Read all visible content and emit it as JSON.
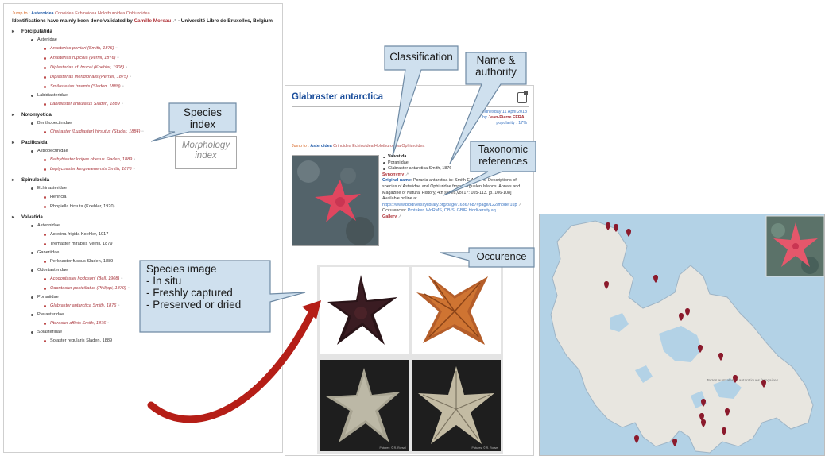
{
  "index": {
    "jump": {
      "label": "Jump to :",
      "active": "Asteroidea",
      "others": "Crinoidea Echinoidea Holothuroidea Ophiuroidea"
    },
    "credit": {
      "prefix": "Identifications have mainly been done/validated by",
      "name": "Camille Moreau",
      "suffix": "- Université Libre de Bruxelles, Belgium"
    },
    "orders": [
      {
        "name": "Forcipulatida",
        "families": [
          {
            "name": "Asteriidae",
            "species": [
              {
                "name": "Anasterias perrieri (Smith, 1876)",
                "linked": true
              },
              {
                "name": "Anasterias rupicola (Verrill, 1876)",
                "linked": true
              },
              {
                "name": "Diplasterias cf. brucei (Koehler, 1908)",
                "linked": true
              },
              {
                "name": "Diplasterias meridionalis (Perrier, 1875)",
                "linked": true
              },
              {
                "name": "Smilasterias triremis (Sladen, 1889)",
                "linked": true
              }
            ]
          },
          {
            "name": "Labidiasteridae",
            "species": [
              {
                "name": "Labidiaster annulatus Sladen, 1889",
                "linked": true
              }
            ]
          }
        ]
      },
      {
        "name": "Notomyotida",
        "families": [
          {
            "name": "Benthopectinidae",
            "species": [
              {
                "name": "Cheiraster (Luidiaster) hirsutus (Studer, 1884)",
                "linked": true
              }
            ]
          }
        ]
      },
      {
        "name": "Paxillosida",
        "families": [
          {
            "name": "Astropectinidae",
            "species": [
              {
                "name": "Bathybiaster loripes obesus Sladen, 1889",
                "linked": true
              },
              {
                "name": "Leptychaster kerguelenensis Smith, 1876",
                "linked": true
              }
            ]
          }
        ]
      },
      {
        "name": "Spinulosida",
        "families": [
          {
            "name": "Echinasteridae",
            "species": [
              {
                "name": "Henricia",
                "linked": false
              },
              {
                "name": "Rhopiella hirsuta (Koehler, 1920)",
                "linked": false
              }
            ]
          }
        ]
      },
      {
        "name": "Valvatida",
        "families": [
          {
            "name": "Asterinidae",
            "species": [
              {
                "name": "Asterina frigida Koehler, 1917",
                "linked": false
              },
              {
                "name": "Tremaster mirabilis Verrill, 1879",
                "linked": false
              }
            ]
          },
          {
            "name": "Ganeriidae",
            "species": [
              {
                "name": "Perknaster fuscus Sladen, 1889",
                "linked": false
              }
            ]
          },
          {
            "name": "Odontasteridae",
            "species": [
              {
                "name": "Acodontaster hodgsoni (Bell, 1908)",
                "linked": true
              },
              {
                "name": "Odontaster penicillatus (Philippi, 1870)",
                "linked": true
              }
            ]
          },
          {
            "name": "Poraniidae",
            "species": [
              {
                "name": "Glabraster antarctica Smith, 1876",
                "linked": true
              }
            ]
          },
          {
            "name": "Pterasteridae",
            "species": [
              {
                "name": "Pteraster affinis Smith, 1876",
                "linked": true
              }
            ]
          },
          {
            "name": "Solasteridae",
            "species": [
              {
                "name": "Solaster regularis Sladen, 1889",
                "linked": false
              }
            ]
          }
        ]
      }
    ]
  },
  "species_page": {
    "title": "Glabraster antarctica",
    "date_line1": "Wednesday 11 April 2018",
    "date_line2_prefix": "by",
    "author": "Jean-Pierre FERAL",
    "popularity": "popularity : 17%",
    "jump": {
      "label": "Jump to :",
      "active": "Asteroidea",
      "others": "Crinoidea Echinoidea Holothuroidea Ophiuroidea"
    },
    "order": "Valvatida",
    "family": "Poraniidae",
    "name_authority": "Glabraster antarctica Smith, 1876",
    "synonymy": "Synonymy",
    "original_label": "Original name",
    "original_text": ": Porania antarctica in: Smith E.A. 1876. Descriptions of species of Asteridae and Ophiuridae from Kerguelen Islands. Annals and Magazine of Natural History, 4th series,vol.17: 105-113. [p. 106-108]",
    "available_prefix": "Available online at",
    "available_url": "https://www.biodiversitylibrary.org/page/16367687#page/122/mode/1up",
    "occ_label": "Occurences:",
    "occ_sources": "Proteker, WoRMS, OBIS, GBIF, biodiversity.aq",
    "gallery": "Gallery",
    "photo_credit": "Pictures: © R. Ronvel"
  },
  "callouts": {
    "species_index": "Species index",
    "morphology_index": "Morphology index",
    "classification": "Classification",
    "name_authority": "Name & authority",
    "taxonomic_references": "Taxonomic references",
    "occurence": "Occurence",
    "species_image_title": "Species image",
    "species_image_items": [
      "- In situ",
      "- Freshly captured",
      "- Preserved or dried"
    ]
  },
  "map": {
    "label": "Terres australes et antarctiques françaises",
    "marker_count": 18,
    "marker_color": "#8b1a2c"
  },
  "colors": {
    "callout_fill": "#cfe0ee",
    "callout_stroke": "#6f8aa4",
    "arrow": "#b51e17",
    "link_red": "#a8343b",
    "link_blue": "#1f5aa8",
    "jump_orange": "#d6631f"
  }
}
